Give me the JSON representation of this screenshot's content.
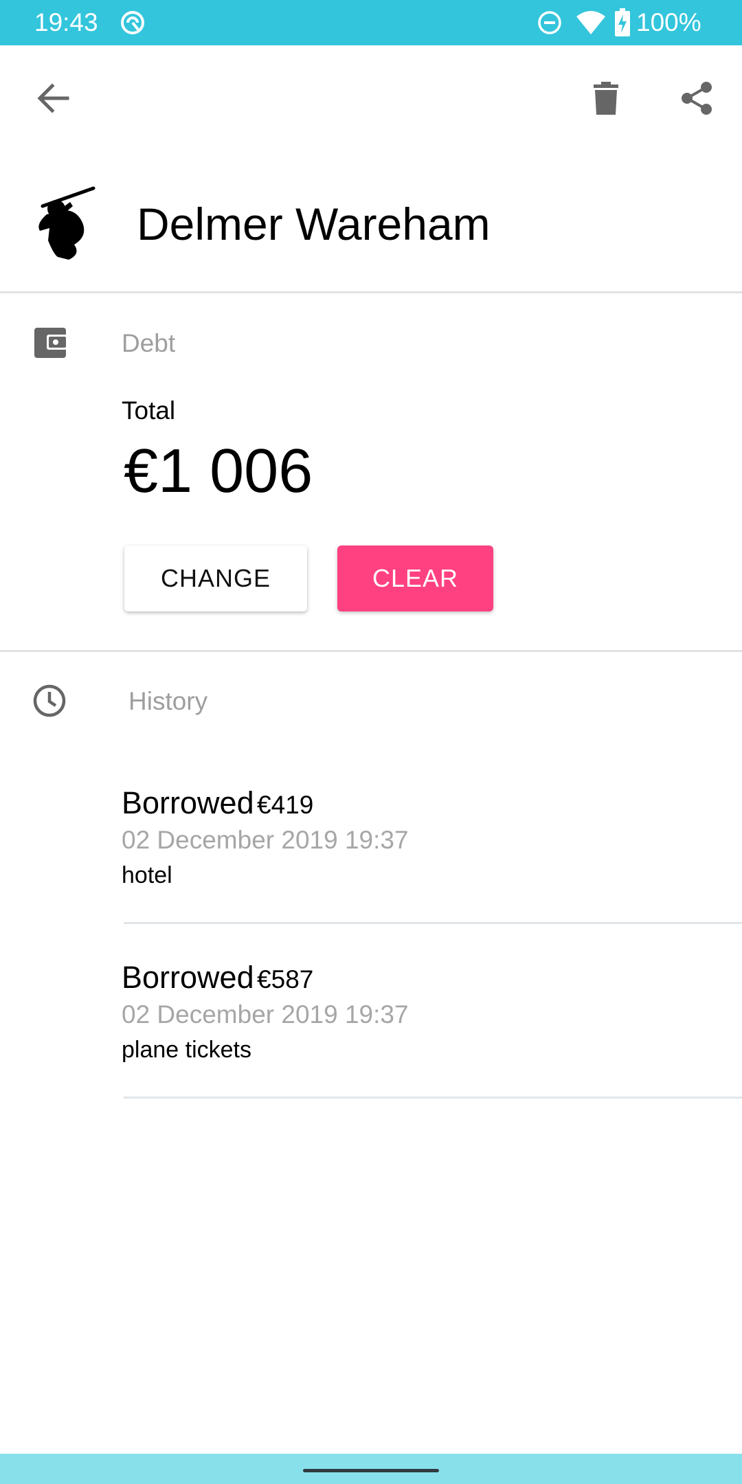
{
  "status_bar": {
    "time": "19:43",
    "battery": "100%",
    "bg_color": "#33c5dc"
  },
  "toolbar": {
    "back_icon": "arrow-back",
    "delete_icon": "trash",
    "share_icon": "share"
  },
  "person": {
    "name": "Delmer Wareham",
    "avatar": "samurai-silhouette"
  },
  "debt": {
    "section_label": "Debt",
    "total_label": "Total",
    "total_amount": "€1 006",
    "change_label": "CHANGE",
    "clear_label": "CLEAR",
    "clear_color": "#ff4081"
  },
  "history": {
    "section_label": "History",
    "items": [
      {
        "type": "Borrowed",
        "amount": "€419",
        "date": "02 December 2019 19:37",
        "note": "hotel"
      },
      {
        "type": "Borrowed",
        "amount": "€587",
        "date": "02 December 2019 19:37",
        "note": "plane tickets"
      }
    ]
  }
}
